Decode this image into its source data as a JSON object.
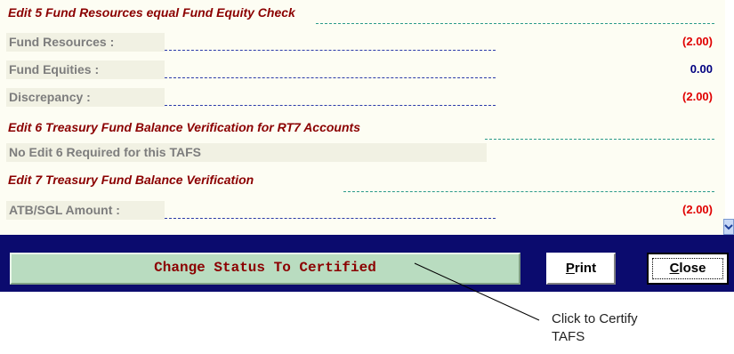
{
  "sections": {
    "edit5_title": "Edit 5 Fund Resources equal Fund Equity Check",
    "edit6_title": "Edit 6 Treasury Fund Balance Verification for RT7 Accounts",
    "edit7_title": "Edit 7 Treasury Fund Balance Verification"
  },
  "rows": {
    "fund_resources": {
      "label": "Fund Resources :",
      "value": "(2.00)"
    },
    "fund_equities": {
      "label": "Fund Equities :",
      "value": "0.00"
    },
    "discrepancy": {
      "label": "Discrepancy :",
      "value": "(2.00)"
    },
    "atb_sgl": {
      "label": "ATB/SGL Amount :",
      "value": "(2.00)"
    }
  },
  "notes": {
    "edit6_note": "No Edit 6 Required for this TAFS"
  },
  "buttons": {
    "certify": "Change Status To Certified",
    "print": "Print",
    "print_accel": "P",
    "print_rest": "rint",
    "close": "Close",
    "close_accel": "C",
    "close_rest": "lose"
  },
  "callout": {
    "line1": "Click to Certify",
    "line2": "TAFS"
  },
  "colors": {
    "section_title": "#8b0000",
    "negative_value": "#e00000",
    "positive_value": "#000080",
    "bottom_bar": "#0b0b6e",
    "certify_button": "#b9dcc0"
  },
  "icons": {
    "scroll": "scroll-down-icon"
  }
}
